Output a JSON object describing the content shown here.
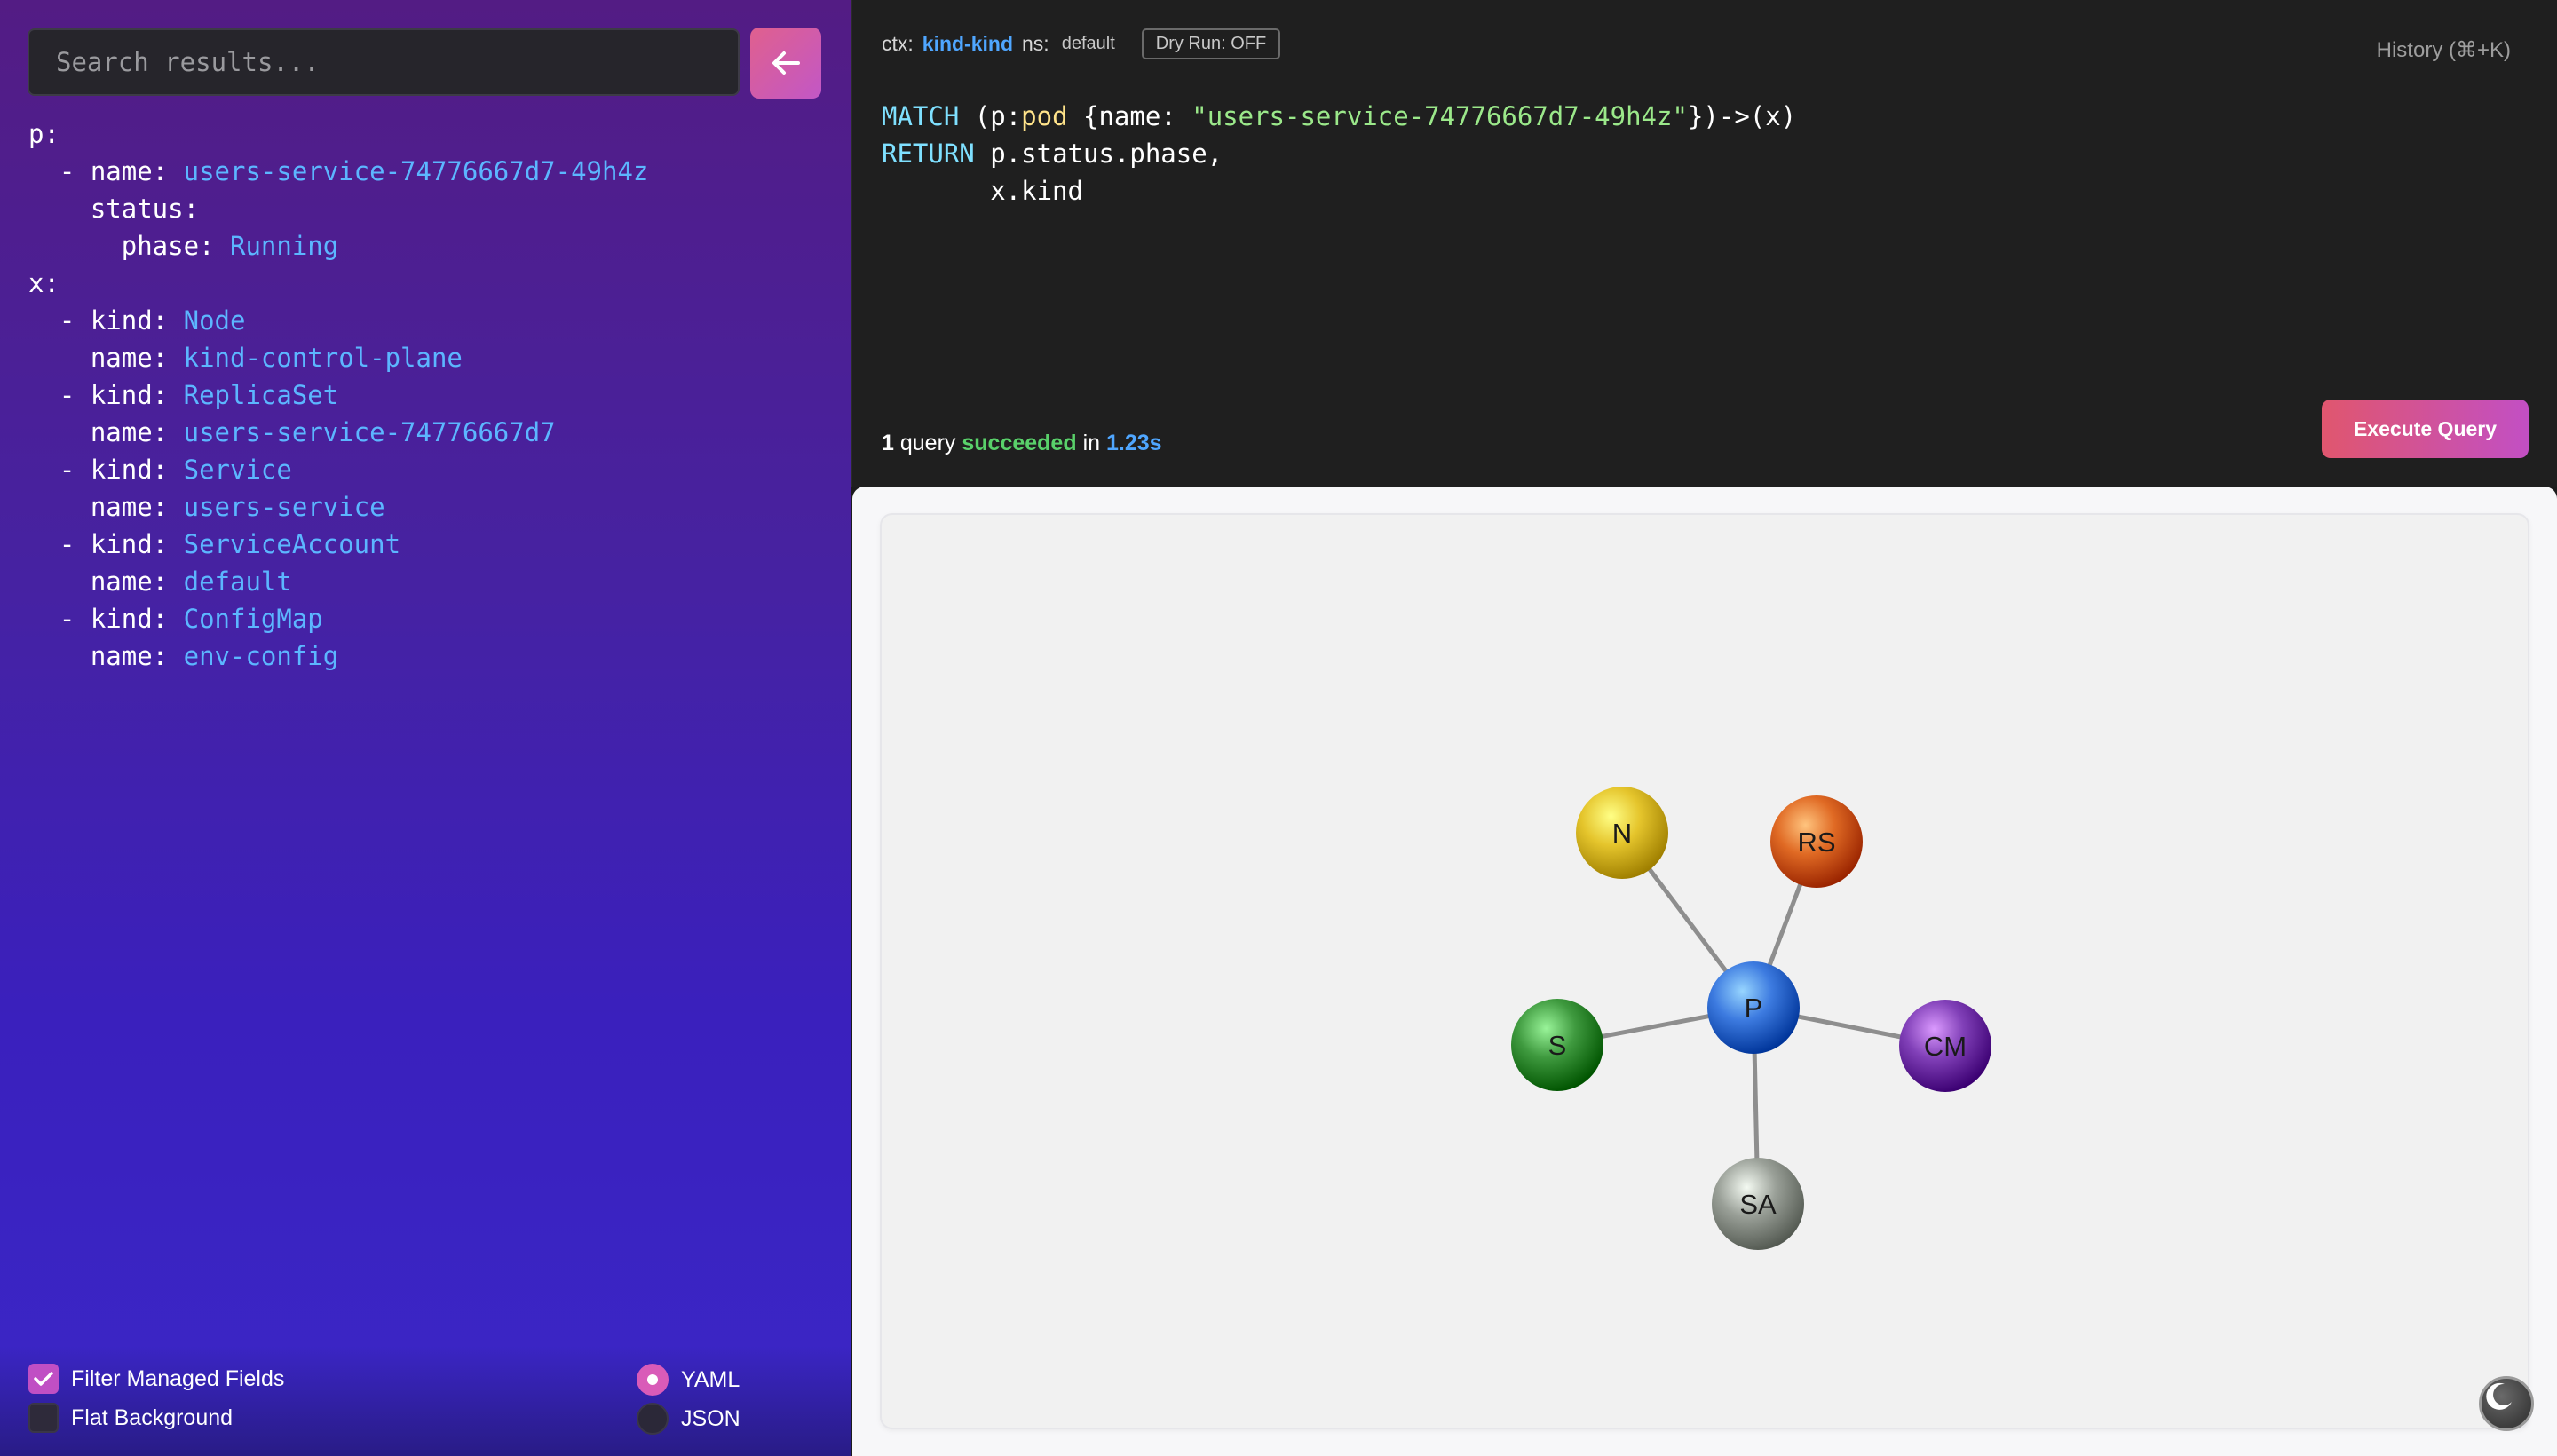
{
  "search": {
    "placeholder": "Search results..."
  },
  "yaml_lines": [
    {
      "indent": "",
      "key": "p:",
      "val": ""
    },
    {
      "indent": "  ",
      "key": "- name: ",
      "val": "users-service-74776667d7-49h4z"
    },
    {
      "indent": "    ",
      "key": "status:",
      "val": ""
    },
    {
      "indent": "      ",
      "key": "phase: ",
      "val": "Running"
    },
    {
      "indent": "",
      "key": "x:",
      "val": ""
    },
    {
      "indent": "  ",
      "key": "- kind: ",
      "val": "Node"
    },
    {
      "indent": "    ",
      "key": "name: ",
      "val": "kind-control-plane"
    },
    {
      "indent": "  ",
      "key": "- kind: ",
      "val": "ReplicaSet"
    },
    {
      "indent": "    ",
      "key": "name: ",
      "val": "users-service-74776667d7"
    },
    {
      "indent": "  ",
      "key": "- kind: ",
      "val": "Service"
    },
    {
      "indent": "    ",
      "key": "name: ",
      "val": "users-service"
    },
    {
      "indent": "  ",
      "key": "- kind: ",
      "val": "ServiceAccount"
    },
    {
      "indent": "    ",
      "key": "name: ",
      "val": "default"
    },
    {
      "indent": "  ",
      "key": "- kind: ",
      "val": "ConfigMap"
    },
    {
      "indent": "    ",
      "key": "name: ",
      "val": "env-config"
    }
  ],
  "options": {
    "filter_managed_fields": {
      "label": "Filter Managed Fields",
      "checked": true
    },
    "flat_background": {
      "label": "Flat Background",
      "checked": false
    },
    "format_yaml": {
      "label": "YAML",
      "selected": true
    },
    "format_json": {
      "label": "JSON",
      "selected": false
    }
  },
  "context": {
    "ctx_label": "ctx:",
    "ctx_value": "kind-kind",
    "ns_label": "ns:",
    "ns_value": "default",
    "dry_run": "Dry Run: OFF"
  },
  "history_label": "History (⌘+K)",
  "query": {
    "l1_kw": "MATCH",
    "l1_a": " (p:",
    "l1_label": "pod",
    "l1_b": " {name: ",
    "l1_str": "\"users-service-74776667d7-49h4z\"",
    "l1_c": "})->(x)",
    "l2_kw": "RETURN",
    "l2_a": " p.status.phase,",
    "l3": "       x.kind"
  },
  "status": {
    "count": "1",
    "word_query": "query",
    "result": "succeeded",
    "word_in": "in",
    "time": "1.23s"
  },
  "execute_label": "Execute Query",
  "graph": {
    "center": {
      "id": "P",
      "label": "P",
      "color": "#3d7be0"
    },
    "nodes": [
      {
        "id": "N",
        "label": "N",
        "color": "#e5c52c"
      },
      {
        "id": "RS",
        "label": "RS",
        "color": "#e06a24"
      },
      {
        "id": "S",
        "label": "S",
        "color": "#3f9a3f"
      },
      {
        "id": "CM",
        "label": "CM",
        "color": "#8140b8"
      },
      {
        "id": "SA",
        "label": "SA",
        "color": "#9aa098"
      }
    ]
  },
  "icons": {
    "back": "arrow-left-icon",
    "theme": "moon-icon",
    "check": "check-icon"
  }
}
